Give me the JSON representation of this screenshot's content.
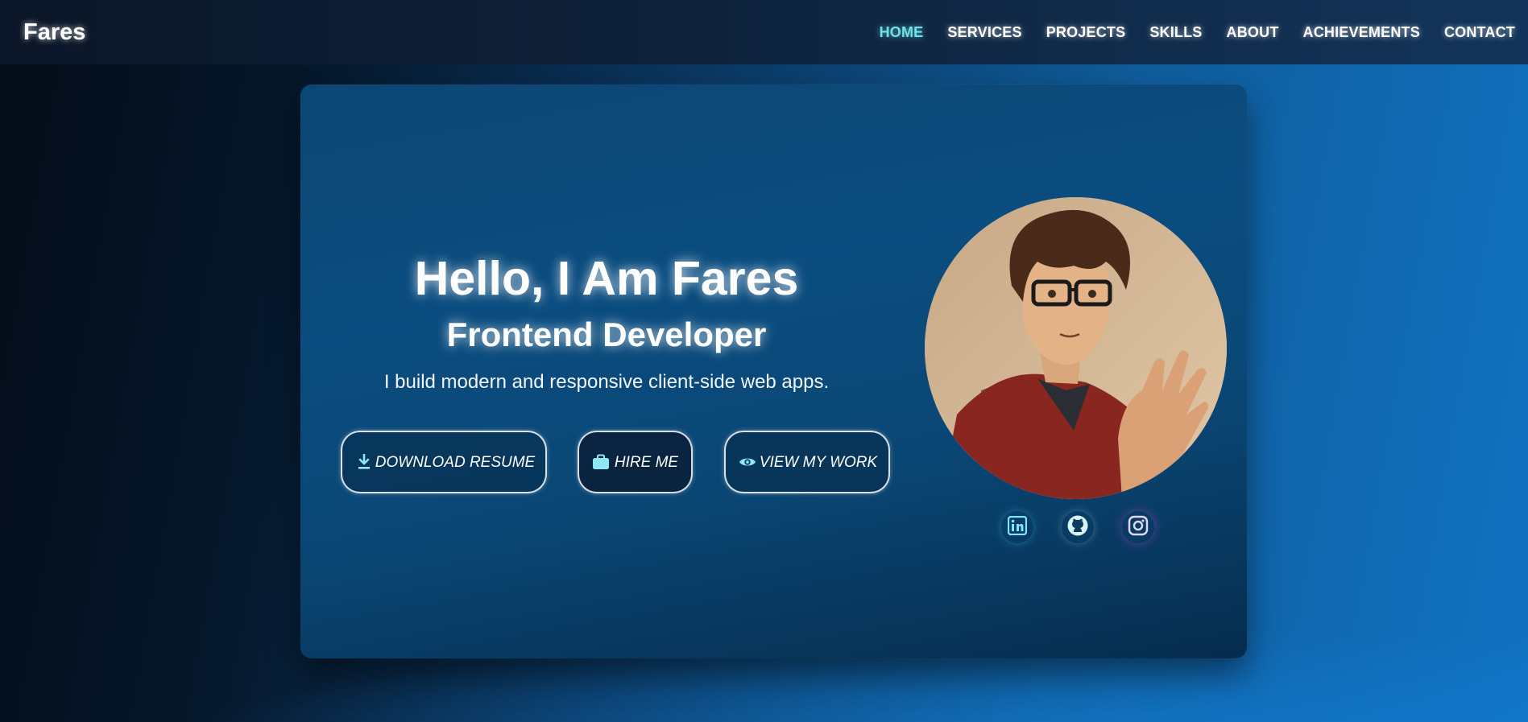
{
  "nav": {
    "brand": "Fares",
    "links": [
      {
        "label": "HOME",
        "active": true
      },
      {
        "label": "SERVICES"
      },
      {
        "label": "PROJECTS"
      },
      {
        "label": "SKILLS"
      },
      {
        "label": "ABOUT"
      },
      {
        "label": "ACHIEVEMENTS"
      },
      {
        "label": "CONTACT"
      }
    ]
  },
  "hero": {
    "title": "Hello, I Am Fares",
    "subtitle": "Frontend Developer",
    "description": "I build modern and responsive client-side web apps.",
    "buttons": {
      "download": {
        "label": "DOWNLOAD RESUME",
        "icon": "download-icon"
      },
      "hire": {
        "label": "HIRE ME",
        "icon": "briefcase-icon"
      },
      "work": {
        "label": "VIEW MY WORK",
        "icon": "eye-icon"
      }
    }
  },
  "socials": [
    {
      "name": "linkedin",
      "icon": "linkedin-icon"
    },
    {
      "name": "github",
      "icon": "github-icon"
    },
    {
      "name": "instagram",
      "icon": "instagram-icon"
    }
  ],
  "colors": {
    "accent": "#6fe3e8",
    "icon": "#8fe9f5"
  }
}
